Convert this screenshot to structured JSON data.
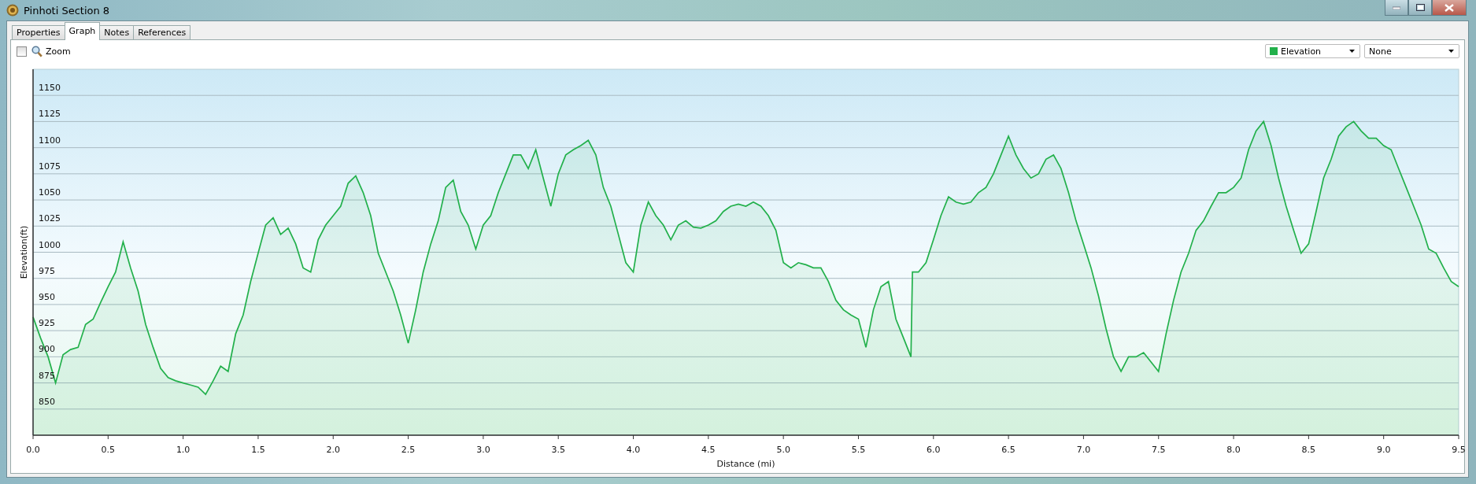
{
  "window": {
    "title": "Pinhoti Section 8"
  },
  "tabs": [
    {
      "label": "Properties",
      "selected": false
    },
    {
      "label": "Graph",
      "selected": true
    },
    {
      "label": "Notes",
      "selected": false
    },
    {
      "label": "References",
      "selected": false
    }
  ],
  "toolbar": {
    "zoom": {
      "label": "Zoom",
      "checked": false
    },
    "second_select": {
      "value": "None"
    }
  },
  "chart_data": {
    "type": "area",
    "grid": true,
    "xlabel": "Distance  (mi)",
    "ylabel": "Elevation(ft)",
    "xlim": [
      0,
      9.5
    ],
    "ylim": [
      825,
      1175
    ],
    "xticks": [
      {
        "value": 0,
        "label": "0.0"
      },
      {
        "value": 0.5,
        "label": "0.5"
      },
      {
        "value": 1,
        "label": "1.0"
      },
      {
        "value": 1.5,
        "label": "1.5"
      },
      {
        "value": 2,
        "label": "2.0"
      },
      {
        "value": 2.5,
        "label": "2.5"
      },
      {
        "value": 3,
        "label": "3.0"
      },
      {
        "value": 3.5,
        "label": "3.5"
      },
      {
        "value": 4,
        "label": "4.0"
      },
      {
        "value": 4.5,
        "label": "4.5"
      },
      {
        "value": 5,
        "label": "5.0"
      },
      {
        "value": 5.5,
        "label": "5.5"
      },
      {
        "value": 6,
        "label": "6.0"
      },
      {
        "value": 6.5,
        "label": "6.5"
      },
      {
        "value": 7,
        "label": "7.0"
      },
      {
        "value": 7.5,
        "label": "7.5"
      },
      {
        "value": 8,
        "label": "8.0"
      },
      {
        "value": 8.5,
        "label": "8.5"
      },
      {
        "value": 9,
        "label": "9.0"
      },
      {
        "value": 9.5,
        "label": "9.5"
      }
    ],
    "yticks": [
      850,
      875,
      900,
      925,
      950,
      975,
      1000,
      1025,
      1050,
      1075,
      1100,
      1125,
      1150
    ],
    "x": [
      0,
      0.05,
      0.1,
      0.15,
      0.2,
      0.25,
      0.3,
      0.35,
      0.4,
      0.45,
      0.5,
      0.55,
      0.6,
      0.65,
      0.7,
      0.75,
      0.8,
      0.85,
      0.9,
      0.95,
      1,
      1.05,
      1.1,
      1.15,
      1.2,
      1.25,
      1.3,
      1.35,
      1.4,
      1.45,
      1.5,
      1.55,
      1.6,
      1.65,
      1.7,
      1.75,
      1.8,
      1.85,
      1.9,
      1.95,
      2,
      2.05,
      2.1,
      2.15,
      2.2,
      2.25,
      2.3,
      2.35,
      2.4,
      2.45,
      2.5,
      2.55,
      2.6,
      2.65,
      2.7,
      2.75,
      2.8,
      2.85,
      2.9,
      2.95,
      3,
      3.05,
      3.1,
      3.15,
      3.2,
      3.25,
      3.3,
      3.35,
      3.4,
      3.45,
      3.5,
      3.55,
      3.6,
      3.65,
      3.7,
      3.75,
      3.8,
      3.85,
      3.9,
      3.95,
      4,
      4.05,
      4.1,
      4.15,
      4.2,
      4.25,
      4.3,
      4.35,
      4.4,
      4.45,
      4.5,
      4.55,
      4.6,
      4.65,
      4.7,
      4.75,
      4.8,
      4.85,
      4.9,
      4.95,
      5,
      5.05,
      5.1,
      5.15,
      5.2,
      5.25,
      5.3,
      5.35,
      5.4,
      5.45,
      5.5,
      5.55,
      5.6,
      5.65,
      5.7,
      5.75,
      5.8,
      5.85,
      5.86,
      5.9,
      5.95,
      6,
      6.05,
      6.1,
      6.15,
      6.2,
      6.25,
      6.3,
      6.35,
      6.4,
      6.45,
      6.5,
      6.55,
      6.6,
      6.65,
      6.7,
      6.75,
      6.8,
      6.85,
      6.9,
      6.95,
      7,
      7.05,
      7.1,
      7.15,
      7.2,
      7.25,
      7.3,
      7.35,
      7.4,
      7.45,
      7.5,
      7.55,
      7.6,
      7.65,
      7.7,
      7.75,
      7.8,
      7.85,
      7.9,
      7.95,
      8,
      8.05,
      8.1,
      8.15,
      8.2,
      8.25,
      8.3,
      8.35,
      8.4,
      8.45,
      8.5,
      8.55,
      8.6,
      8.65,
      8.7,
      8.75,
      8.8,
      8.85,
      8.9,
      8.95,
      9,
      9.05,
      9.1,
      9.15,
      9.2,
      9.25,
      9.3,
      9.35,
      9.4,
      9.45,
      9.5
    ],
    "series": [
      {
        "name": "Elevation",
        "color": "#22b04b",
        "values": [
          938,
          918,
          900,
          875,
          902,
          907,
          909,
          931,
          936,
          952,
          967,
          981,
          1010,
          985,
          963,
          931,
          909,
          889,
          880,
          877,
          875,
          873,
          871,
          864,
          877,
          891,
          886,
          922,
          940,
          972,
          999,
          1026,
          1033,
          1017,
          1023,
          1008,
          985,
          981,
          1012,
          1026,
          1035,
          1044,
          1066,
          1073,
          1057,
          1035,
          999,
          981,
          963,
          940,
          913,
          945,
          981,
          1008,
          1030,
          1062,
          1069,
          1039,
          1026,
          1003,
          1026,
          1035,
          1057,
          1075,
          1093,
          1093,
          1080,
          1098,
          1071,
          1044,
          1075,
          1093,
          1098,
          1102,
          1107,
          1093,
          1062,
          1044,
          1017,
          990,
          981,
          1026,
          1048,
          1035,
          1026,
          1012,
          1026,
          1030,
          1024,
          1023,
          1026,
          1030,
          1039,
          1044,
          1046,
          1044,
          1048,
          1044,
          1035,
          1021,
          990,
          985,
          990,
          988,
          985,
          985,
          972,
          954,
          945,
          940,
          936,
          909,
          945,
          967,
          972,
          936,
          918,
          900,
          981,
          981,
          990,
          1012,
          1035,
          1053,
          1048,
          1046,
          1048,
          1057,
          1062,
          1075,
          1093,
          1111,
          1093,
          1080,
          1071,
          1075,
          1089,
          1093,
          1080,
          1057,
          1030,
          1008,
          985,
          958,
          927,
          900,
          886,
          900,
          900,
          904,
          895,
          886,
          922,
          954,
          981,
          999,
          1021,
          1030,
          1044,
          1057,
          1057,
          1062,
          1071,
          1098,
          1116,
          1125,
          1102,
          1071,
          1044,
          1021,
          999,
          1008,
          1039,
          1071,
          1089,
          1111,
          1120,
          1125,
          1116,
          1109,
          1109,
          1102,
          1098,
          1080,
          1062,
          1044,
          1026,
          1003,
          999,
          985,
          972,
          967
        ]
      }
    ]
  }
}
